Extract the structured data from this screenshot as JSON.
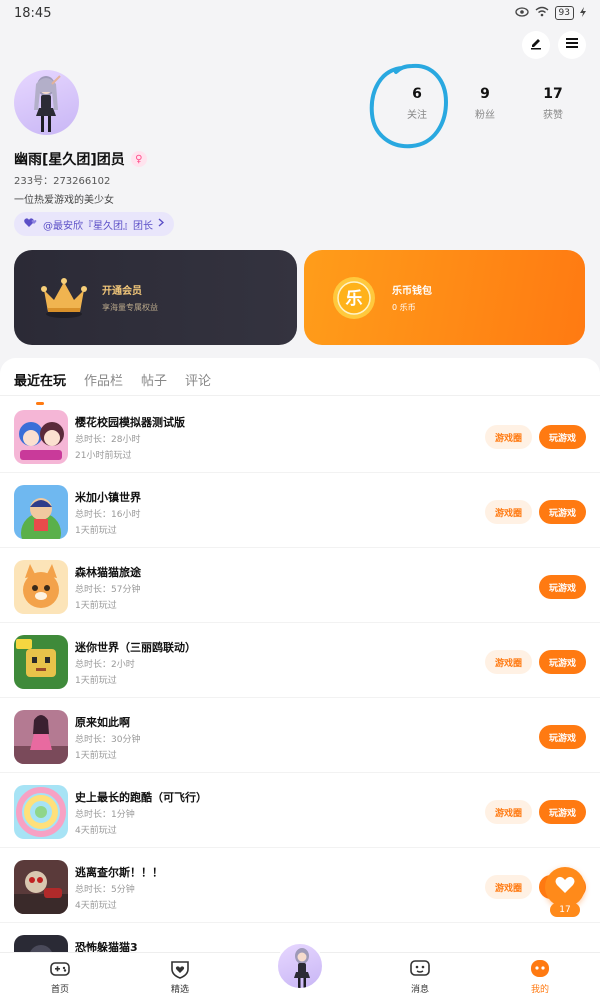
{
  "status_bar": {
    "time": "18:45",
    "battery": "93"
  },
  "profile": {
    "name": "幽雨[星久团]团员",
    "gender_symbol": "♀",
    "uid": "233号：273266102",
    "bio": "一位热爱游戏的美少女",
    "team_tag": "@最安欣『星久团』团长",
    "stats": [
      {
        "value": "6",
        "label": "关注"
      },
      {
        "value": "9",
        "label": "粉丝"
      },
      {
        "value": "17",
        "label": "获赞"
      }
    ]
  },
  "cards": {
    "vip": {
      "title": "开通会员",
      "subtitle": "享海量专属权益"
    },
    "wallet": {
      "title": "乐币钱包",
      "subtitle": "0 乐币",
      "coin_char": "乐"
    }
  },
  "tabs": [
    "最近在玩",
    "作品栏",
    "帖子",
    "评论"
  ],
  "games": [
    {
      "title": "樱花校园模拟器测试版",
      "duration": "总时长：28小时",
      "last": "21小时前玩过",
      "has_circle": true
    },
    {
      "title": "米加小镇世界",
      "duration": "总时长：16小时",
      "last": "1天前玩过",
      "has_circle": true
    },
    {
      "title": "森林猫猫旅途",
      "duration": "总时长：57分钟",
      "last": "1天前玩过",
      "has_circle": false
    },
    {
      "title": "迷你世界（三丽鸥联动）",
      "duration": "总时长：2小时",
      "last": "1天前玩过",
      "has_circle": true
    },
    {
      "title": "原来如此啊",
      "duration": "总时长：30分钟",
      "last": "1天前玩过",
      "has_circle": false
    },
    {
      "title": "史上最长的跑酷（可飞行）",
      "duration": "总时长：1分钟",
      "last": "4天前玩过",
      "has_circle": true
    },
    {
      "title": "逃离查尔斯！！！",
      "duration": "总时长：5分钟",
      "last": "4天前玩过",
      "has_circle": true
    },
    {
      "title": "恐怖躲猫猫3",
      "duration": "",
      "last": "",
      "has_circle": false
    }
  ],
  "buttons": {
    "circle": "游戏圈",
    "play": "玩游戏"
  },
  "like_float": {
    "count": "17"
  },
  "bottom_nav": [
    {
      "label": "首页",
      "icon": "gamepad-icon"
    },
    {
      "label": "精选",
      "icon": "heart-shield-icon"
    },
    {
      "label": "消息",
      "icon": "message-icon"
    },
    {
      "label": "我的",
      "icon": "profile-face-icon"
    }
  ],
  "colors": {
    "accent": "#ff7a12",
    "scribble": "#29a8e0"
  }
}
